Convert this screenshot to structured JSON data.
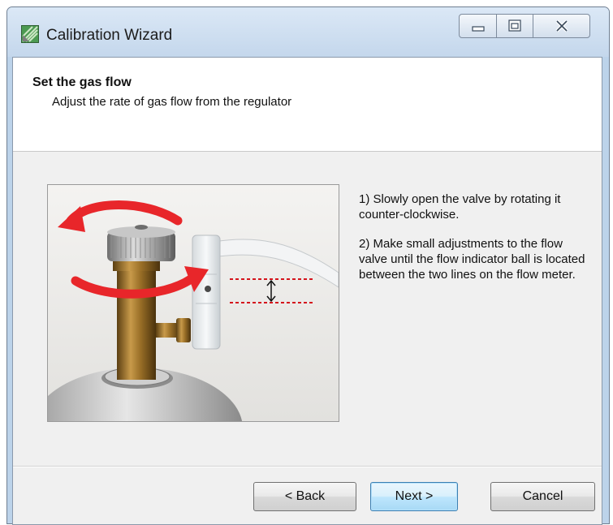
{
  "window": {
    "title": "Calibration Wizard",
    "icon": "app-icon"
  },
  "caption_buttons": {
    "minimize_icon": "minimize-icon",
    "maximize_icon": "maximize-icon",
    "close_icon": "close-icon"
  },
  "header": {
    "title": "Set the gas flow",
    "subtitle": "Adjust the rate of gas flow from the regulator"
  },
  "instructions": {
    "step1": "1) Slowly open the valve by rotating it counter-clockwise.",
    "step2": "2) Make small adjustments to the flow valve until the flow indicator ball is located between the two lines on the flow meter."
  },
  "footer": {
    "back_label": "< Back",
    "next_label": "Next >",
    "cancel_label": "Cancel"
  },
  "colors": {
    "arrow": "#e8262a",
    "guide_lines": "#d4141c",
    "default_button_border": "#3c7fb1"
  }
}
